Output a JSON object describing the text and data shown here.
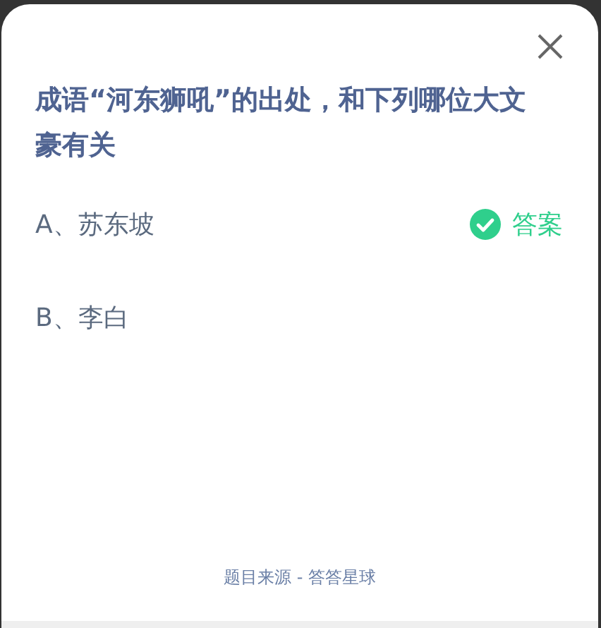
{
  "question": "成语“河东狮吼”的出处，和下列哪位大文豪有关",
  "options": [
    {
      "label": "A、苏东坡",
      "correct": true
    },
    {
      "label": "B、李白",
      "correct": false
    }
  ],
  "answer_label": "答案",
  "source": "题目来源 - 答答星球"
}
